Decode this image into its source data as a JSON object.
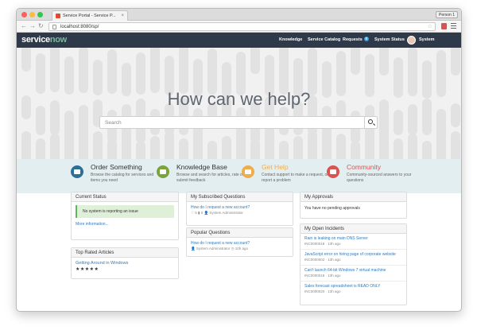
{
  "browser": {
    "tab_title": "Service Portal - Service P...",
    "profile": "Person 1",
    "url": "localhost:8080/sp/"
  },
  "header": {
    "logo_main": "service",
    "logo_accent": "now",
    "nav": [
      "Knowledge",
      "Service Catalog",
      "Requests",
      "System Status"
    ],
    "requests_badge": "0",
    "user_name": "System Administrator"
  },
  "hero": {
    "title": "How can we help?",
    "search_placeholder": "Search"
  },
  "features": [
    {
      "title": "Order Something",
      "desc": "Browse the catalog for services and items you need",
      "color": "#2e6f95",
      "icon": "briefcase-icon"
    },
    {
      "title": "Knowledge Base",
      "desc": "Browse and search for articles, rate or submit feedback",
      "color": "#7aa33b",
      "icon": "book-icon"
    },
    {
      "title": "Get Help",
      "desc": "Contact support to make a request, or report a problem",
      "color": "#f0ad4e",
      "icon": "help-icon"
    },
    {
      "title": "Community",
      "desc": "Community-sourced answers to your questions",
      "color": "#d9534f",
      "icon": "community-icon"
    }
  ],
  "current_status": {
    "title": "Current Status",
    "message": "No system is reporting an issue",
    "more_link": "More information..."
  },
  "top_rated": {
    "title": "Top Rated Articles",
    "article": "Getting Around in Windows",
    "stars": "★★★★★"
  },
  "subscribed": {
    "title": "My Subscribed Questions",
    "question": "How do I request a new account?",
    "meta": "♡ 5   ▮ 0   👤 System Administrator"
  },
  "popular": {
    "title": "Popular Questions",
    "question": "How do I request a new account?",
    "meta": "👤 System Administrator   ◷ 10h ago"
  },
  "approvals": {
    "title": "My Approvals",
    "message": "You have no pending approvals"
  },
  "incidents": {
    "title": "My Open Incidents",
    "items": [
      {
        "title": "Rain is leaking on main DNS Server",
        "meta": "INC0000018 · 13h ago"
      },
      {
        "title": "JavaScript error on hiring page of corporate website",
        "meta": "INC0000002 · 13h ago"
      },
      {
        "title": "Can't launch 64-bit Windows 7 virtual machine",
        "meta": "INC0000019 · 13h ago"
      },
      {
        "title": "Sales forecast spreadsheet is READ ONLY",
        "meta": "INC0000020 · 13h ago"
      }
    ]
  }
}
